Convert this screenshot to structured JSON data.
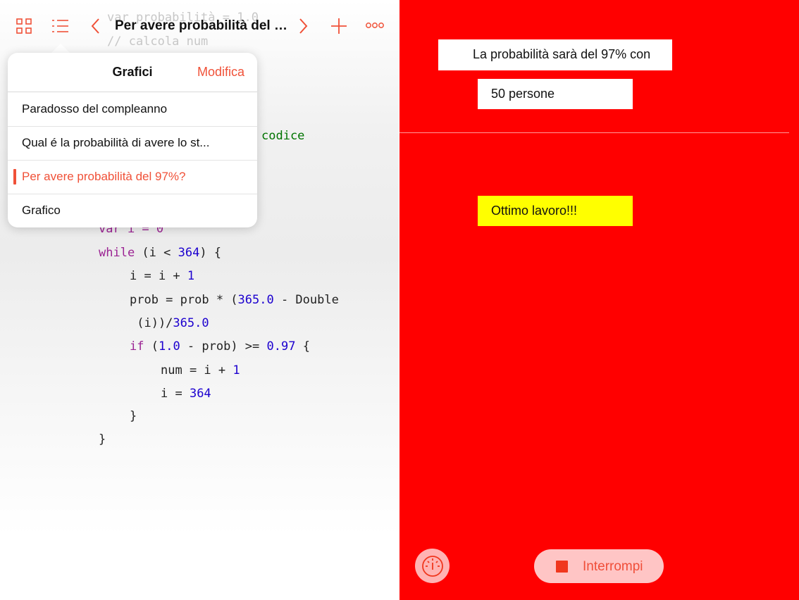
{
  "toolbar": {
    "title": "Per avere probabilità del 9...",
    "icons": [
      "grid-icon",
      "list-icon",
      "chevron-left-icon",
      "chevron-right-icon",
      "plus-icon",
      "more-icon"
    ],
    "accent": "#f05138"
  },
  "popover": {
    "title": "Grafici",
    "edit_label": "Modifica",
    "items": [
      {
        "label": "Paradosso del compleanno"
      },
      {
        "label": "Qual é la probabilità di avere lo st..."
      },
      {
        "label": "Per avere probabilità del 97%?",
        "selected": true
      },
      {
        "label": "Grafico"
      }
    ]
  },
  "code": {
    "ghost_line_1": "var probabilità = 1.0",
    "ghost_line_2": "// calcola num",
    "visible_comment": "codice",
    "line_var": "var i = 0",
    "line_while_kw": "while",
    "line_while_rest": " (i < ",
    "line_while_num": "364",
    "line_while_end": ") {",
    "line_inc_a": "i = i + ",
    "line_inc_num": "1",
    "line_prob_a": "prob = prob * (",
    "line_prob_num": "365.0",
    "line_prob_b": " - Double",
    "line_prob2_a": " (i))/",
    "line_prob2_num": "365.0",
    "line_if_kw": "if",
    "line_if_a": " (",
    "line_if_num1": "1.0",
    "line_if_b": " - prob) >= ",
    "line_if_num2": "0.97",
    "line_if_c": " {",
    "line_num_a": "num = i + ",
    "line_num_num": "1",
    "line_i_a": "i = ",
    "line_i_num": "364",
    "close_inner": "}",
    "close_outer": "}"
  },
  "liveview": {
    "background": "#ff0000",
    "label_top": "La probabilità sarà del 97% con",
    "label_persons": "50  persone",
    "label_success": "Ottimo lavoro!!!",
    "stop_label": "Interrompi",
    "meter_icon": "speedometer-icon",
    "stop_icon": "stop-icon"
  }
}
